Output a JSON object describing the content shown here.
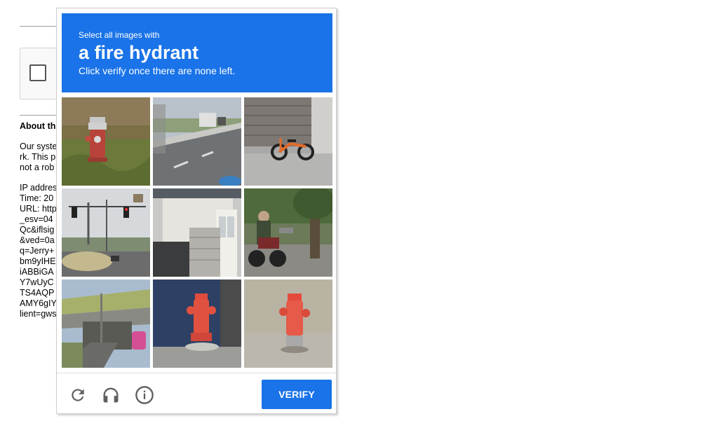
{
  "background_page": {
    "about_heading": "About th",
    "paragraph_lines": [
      "Our syste",
      "rk. This p",
      "not a rob"
    ],
    "info_lines": [
      "IP addres",
      "Time: 20",
      "URL: http",
      "_esv=04",
      "Qc&iflsig",
      "&ved=0a",
      "q=Jerry+",
      "bm9yIHE",
      "iABBiGA",
      "Y7wUyC",
      "TS4AQP",
      "AMY6gIY",
      "lient=gws"
    ]
  },
  "captcha": {
    "prompt_intro": "Select all images with",
    "target_object": "a fire hydrant",
    "instruction": "Click verify once there are none left.",
    "tiles": [
      {
        "description": "red and silver fire hydrant in dry grass"
      },
      {
        "description": "road with cars and highway"
      },
      {
        "description": "orange balance bike near garage"
      },
      {
        "description": "traffic light and tanker truck on road"
      },
      {
        "description": "house entrance with bricks"
      },
      {
        "description": "person riding motorcycle near tree"
      },
      {
        "description": "highway overpass with pink car"
      },
      {
        "description": "red fire hydrant on sidewalk"
      },
      {
        "description": "red fire hydrant by wall"
      }
    ],
    "footer": {
      "reload_icon": "reload-icon",
      "audio_icon": "headphones-icon",
      "info_icon": "info-icon",
      "verify_label": "VERIFY"
    },
    "colors": {
      "accent": "#1a73e8"
    }
  }
}
